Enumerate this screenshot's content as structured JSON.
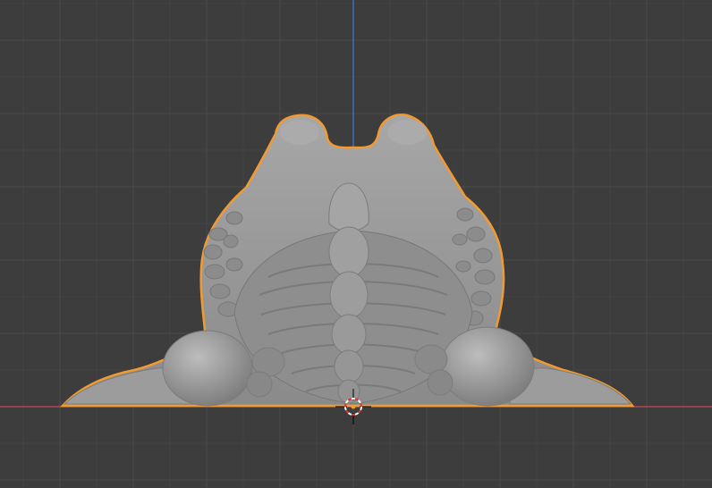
{
  "app": {
    "view": "front-orthographic",
    "grid": true,
    "selected_object": true
  },
  "colors": {
    "background": "#3d3d3d",
    "grid_minor": "#444444",
    "grid_major": "#4b4b4b",
    "axis_x": "#b8434d",
    "axis_z": "#3a6fc2",
    "selection_outline": "#f29a32",
    "model_fill": "#9a9a9a",
    "model_shadow": "#7e7e7e",
    "model_highlight": "#b4b4b4"
  },
  "icons": {
    "cursor": "3d-cursor-icon"
  }
}
